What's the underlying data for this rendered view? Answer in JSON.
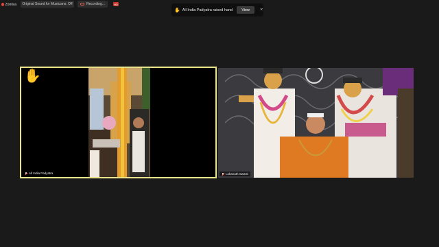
{
  "topbar": {
    "rec_label": "Zomiva",
    "sound_label": "Original Sound for Musicians: Off",
    "recording_label": "Recording...",
    "hd_label": "HD"
  },
  "notification": {
    "message": "All India Padyatra raised hand",
    "view_label": "View",
    "close_glyph": "×"
  },
  "participants": [
    {
      "name": "All India Padyatra",
      "hand_raised": true,
      "muted": true
    },
    {
      "name": "Lokanath Swami",
      "hand_raised": false,
      "muted": true
    }
  ],
  "colors": {
    "background": "#1a1a1a",
    "active_speaker_border": "#e9e38c",
    "raised_hand": "#f5c21b",
    "recording": "#e0453a"
  }
}
